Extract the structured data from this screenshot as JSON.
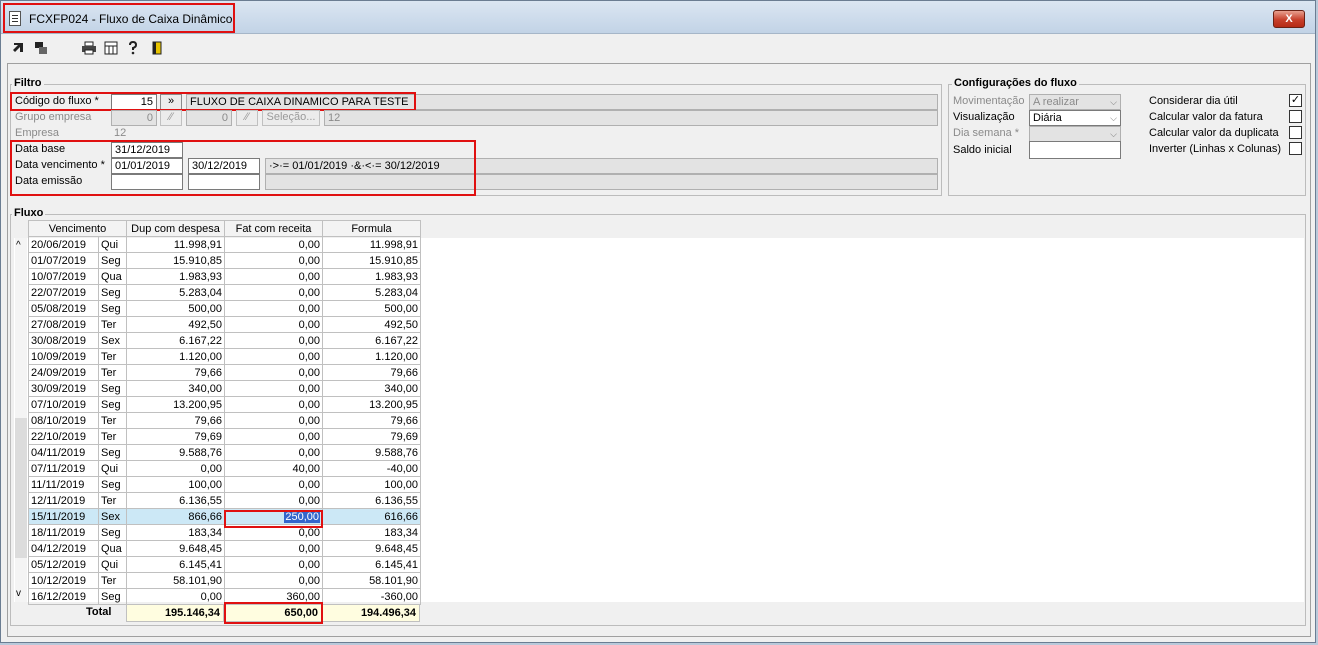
{
  "window": {
    "title": "FCXFP024 - Fluxo de Caixa Dinâmico",
    "close_label": "X"
  },
  "toolbar": {
    "icons": [
      "arrow-icon",
      "windows-icon",
      "printer-icon",
      "calculator-icon",
      "help-icon",
      "exit-icon"
    ]
  },
  "filtro": {
    "title": "Filtro",
    "codigo_label": "Código do fluxo *",
    "codigo_value": "15",
    "codigo_btn": "»",
    "codigo_desc": "FLUXO DE CAIXA DINAMICO PARA TESTE",
    "grupo_label": "Grupo empresa",
    "grupo_value1": "0",
    "grupo_value2": "0",
    "grupo_sel_btn": "Seleção...",
    "grupo_right": "12",
    "empresa_label": "Empresa",
    "empresa_value": "12",
    "data_base_label": "Data base",
    "data_base_value": "31/12/2019",
    "data_venc_label": "Data vencimento *",
    "data_venc_from": "01/01/2019",
    "data_venc_to": "30/12/2019",
    "data_venc_expr": "·>·= 01/01/2019 ·&·<·= 30/12/2019",
    "data_emissao_label": "Data emissão",
    "data_emissao_from": "",
    "data_emissao_to": ""
  },
  "config": {
    "title": "Configurações do fluxo",
    "movimentacao_label": "Movimentação",
    "movimentacao_value": "A realizar",
    "visualizacao_label": "Visualização",
    "visualizacao_value": "Diária",
    "dia_semana_label": "Dia semana *",
    "dia_semana_value": "",
    "saldo_label": "Saldo inicial",
    "saldo_value": "",
    "checks": [
      {
        "label": "Considerar dia útil",
        "checked": true
      },
      {
        "label": "Calcular valor da fatura",
        "checked": false
      },
      {
        "label": "Calcular valor da duplicata",
        "checked": false
      },
      {
        "label": "Inverter (Linhas x Colunas)",
        "checked": false
      }
    ]
  },
  "fluxo": {
    "title": "Fluxo",
    "columns": [
      "Vencimento",
      "Dup com despesa",
      "Fat com receita",
      "Formula"
    ],
    "rows": [
      [
        "20/06/2019",
        "Qui",
        "11.998,91",
        "0,00",
        "11.998,91"
      ],
      [
        "01/07/2019",
        "Seg",
        "15.910,85",
        "0,00",
        "15.910,85"
      ],
      [
        "10/07/2019",
        "Qua",
        "1.983,93",
        "0,00",
        "1.983,93"
      ],
      [
        "22/07/2019",
        "Seg",
        "5.283,04",
        "0,00",
        "5.283,04"
      ],
      [
        "05/08/2019",
        "Seg",
        "500,00",
        "0,00",
        "500,00"
      ],
      [
        "27/08/2019",
        "Ter",
        "492,50",
        "0,00",
        "492,50"
      ],
      [
        "30/08/2019",
        "Sex",
        "6.167,22",
        "0,00",
        "6.167,22"
      ],
      [
        "10/09/2019",
        "Ter",
        "1.120,00",
        "0,00",
        "1.120,00"
      ],
      [
        "24/09/2019",
        "Ter",
        "79,66",
        "0,00",
        "79,66"
      ],
      [
        "30/09/2019",
        "Seg",
        "340,00",
        "0,00",
        "340,00"
      ],
      [
        "07/10/2019",
        "Seg",
        "13.200,95",
        "0,00",
        "13.200,95"
      ],
      [
        "08/10/2019",
        "Ter",
        "79,66",
        "0,00",
        "79,66"
      ],
      [
        "22/10/2019",
        "Ter",
        "79,69",
        "0,00",
        "79,69"
      ],
      [
        "04/11/2019",
        "Seg",
        "9.588,76",
        "0,00",
        "9.588,76"
      ],
      [
        "07/11/2019",
        "Qui",
        "0,00",
        "40,00",
        "-40,00"
      ],
      [
        "11/11/2019",
        "Seg",
        "100,00",
        "0,00",
        "100,00"
      ],
      [
        "12/11/2019",
        "Ter",
        "6.136,55",
        "0,00",
        "6.136,55"
      ],
      [
        "15/11/2019",
        "Sex",
        "866,66",
        "250,00",
        "616,66"
      ],
      [
        "18/11/2019",
        "Seg",
        "183,34",
        "0,00",
        "183,34"
      ],
      [
        "04/12/2019",
        "Qua",
        "9.648,45",
        "0,00",
        "9.648,45"
      ],
      [
        "05/12/2019",
        "Qui",
        "6.145,41",
        "0,00",
        "6.145,41"
      ],
      [
        "10/12/2019",
        "Ter",
        "58.101,90",
        "0,00",
        "58.101,90"
      ],
      [
        "16/12/2019",
        "Seg",
        "0,00",
        "360,00",
        "-360,00"
      ]
    ],
    "selected_row": 17,
    "total_label": "Total",
    "totals": [
      "195.146,34",
      "650,00",
      "194.496,34"
    ]
  }
}
